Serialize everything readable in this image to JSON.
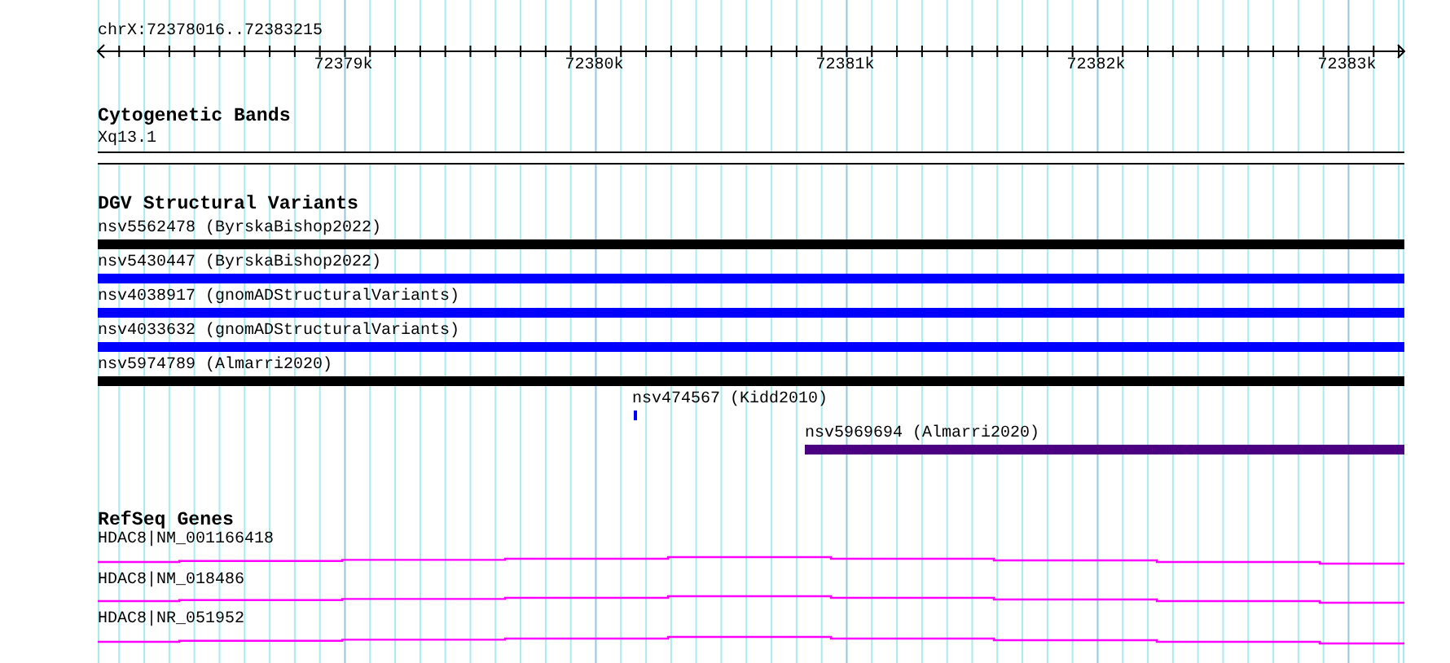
{
  "ruler": {
    "position": "chrX:72378016..72383215",
    "ticks": [
      "72379k",
      "72380k",
      "72381k",
      "72382k",
      "72383k"
    ]
  },
  "tracks": [
    {
      "kind": "bands",
      "title": "Cytogenetic Bands",
      "items": [
        {
          "label": "Xq13.1"
        }
      ]
    },
    {
      "kind": "variants",
      "title": "DGV Structural Variants",
      "items": [
        {
          "label": "nsv5562478 (ByrskaBishop2022)",
          "color": "#000000"
        },
        {
          "label": "nsv5430447 (ByrskaBishop2022)",
          "color": "#0000ff"
        },
        {
          "label": "nsv4038917 (gnomADStructuralVariants)",
          "color": "#0000ff"
        },
        {
          "label": "nsv4033632 (gnomADStructuralVariants)",
          "color": "#0000ff"
        },
        {
          "label": "nsv5974789 (Almarri2020)",
          "color": "#000000"
        },
        {
          "label": "nsv474567 (Kidd2010)",
          "color": "#0000ff"
        },
        {
          "label": "nsv5969694 (Almarri2020)",
          "color": "#4b0082"
        }
      ]
    },
    {
      "kind": "genes",
      "title": "RefSeq Genes",
      "items": [
        {
          "label": "HDAC8|NM_001166418"
        },
        {
          "label": "HDAC8|NM_018486"
        },
        {
          "label": "HDAC8|NR_051952"
        }
      ]
    }
  ]
}
